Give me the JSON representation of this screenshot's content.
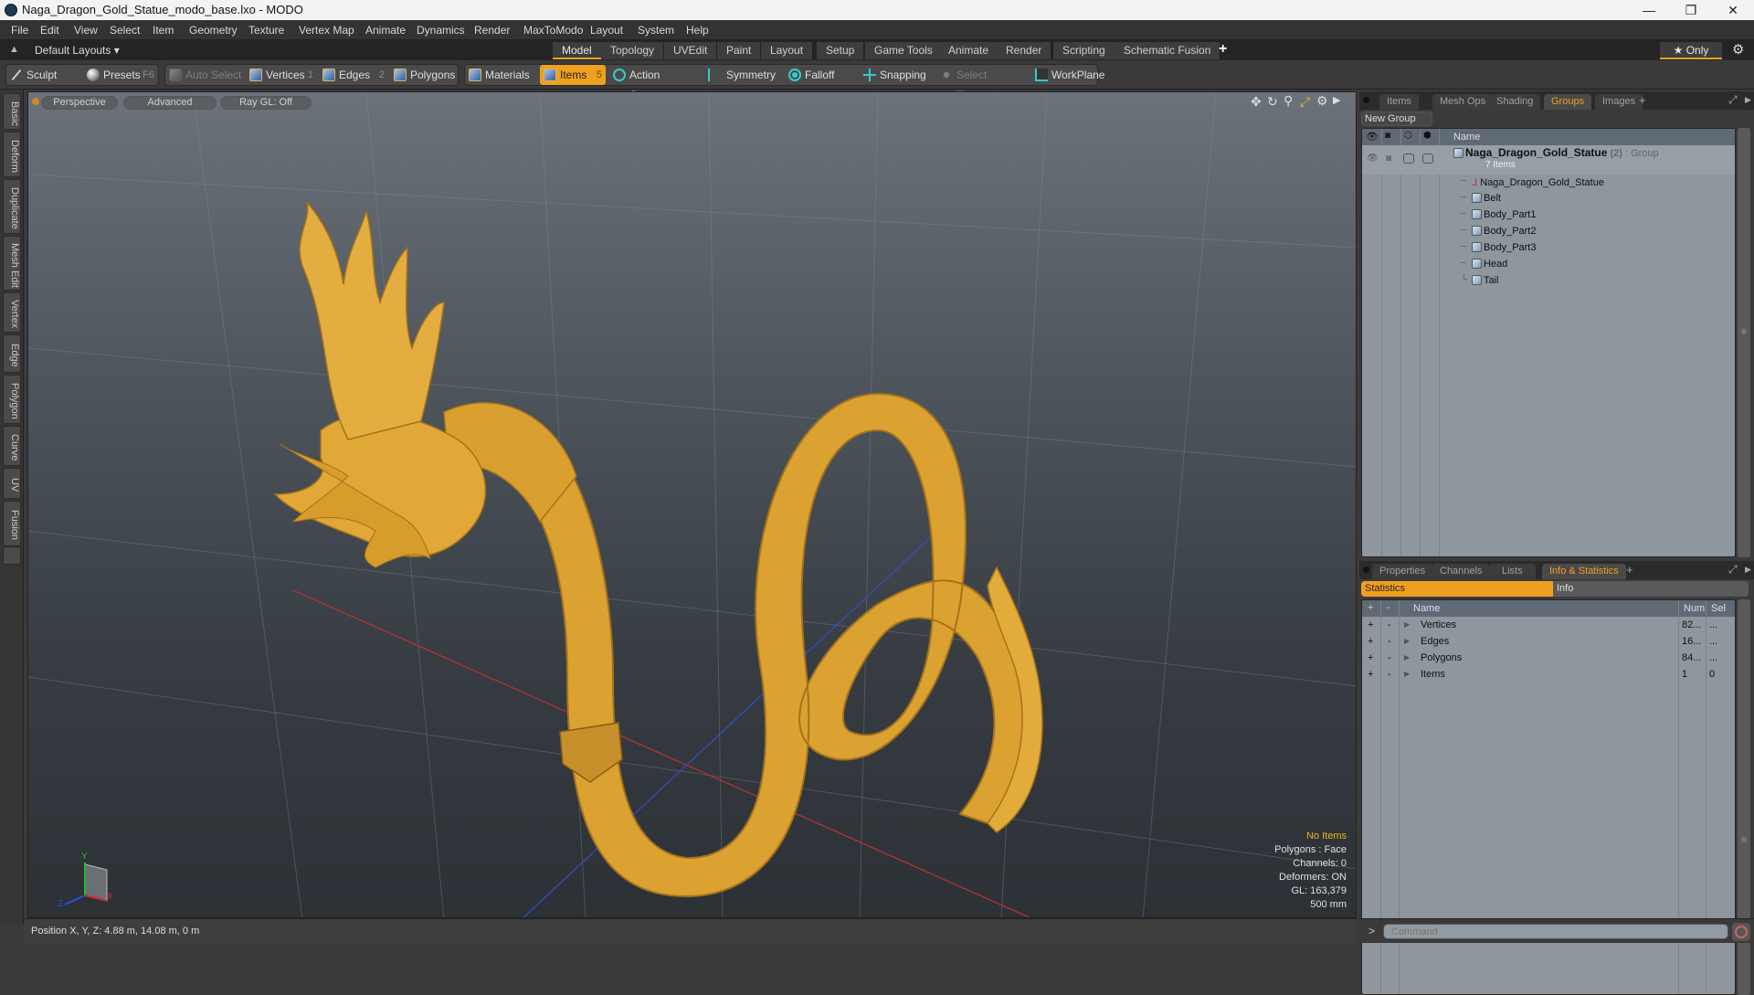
{
  "window": {
    "title": "Naga_Dragon_Gold_Statue_modo_base.lxo - MODO",
    "controls": [
      "—",
      "❐",
      "✕"
    ]
  },
  "menu": [
    "File",
    "Edit",
    "View",
    "Select",
    "Item",
    "Geometry",
    "Texture",
    "Vertex Map",
    "Animate",
    "Dynamics",
    "Render",
    "MaxToModo",
    "Layout",
    "System",
    "Help"
  ],
  "layoutbar": {
    "layouts_label": "Default Layouts ▾",
    "tabs": [
      "Model",
      "Topology",
      "UVEdit",
      "Paint",
      "Layout",
      "Setup",
      "Game Tools",
      "Animate",
      "Render",
      "Scripting",
      "Schematic Fusion"
    ],
    "active_tab": "Model",
    "add_label": "+",
    "only_label": "★  Only",
    "gear": "⚙"
  },
  "toolbar": {
    "sculpt": "Sculpt",
    "presets": "Presets",
    "presets_key": "F6",
    "auto_select": "Auto Select",
    "vertices": "Vertices",
    "vertices_key": "1",
    "edges": "Edges",
    "edges_key": "2",
    "polygons": "Polygons",
    "materials": "Materials",
    "items": "Items",
    "items_key": "5",
    "action_center": "Action Center",
    "symmetry": "Symmetry",
    "falloff": "Falloff",
    "snapping": "Snapping",
    "select_through": "Select Through",
    "workplane": "WorkPlane"
  },
  "left_tabs": [
    "Basic",
    "Deform",
    "Duplicate",
    "Mesh Edit",
    "Vertex",
    "Edge",
    "Polygon",
    "Curve",
    "UV",
    "Fusion"
  ],
  "viewport": {
    "view_label": "Perspective",
    "shading_label": "Advanced",
    "raygl_label": "Ray GL: Off",
    "hud": {
      "selection": "No Items",
      "polygons": "Polygons : Face",
      "channels": "Channels: 0",
      "deformers": "Deformers: ON",
      "gl": "GL: 163,379",
      "scale": "500 mm"
    },
    "axis_labels": {
      "x": "X",
      "y": "Y",
      "z": "Z"
    },
    "model_color": "#e0a633"
  },
  "status": {
    "position": "Position X, Y, Z:   4.88 m, 14.08 m, 0 m"
  },
  "groups_panel": {
    "tabs": [
      "Items",
      "Mesh Ops",
      "Shading",
      "Groups",
      "Images"
    ],
    "active_tab": "Groups",
    "new_group": "New Group",
    "column_name": "Name",
    "group": {
      "name": "Naga_Dragon_Gold_Statue",
      "count": "(2)",
      "type": ": Group",
      "sub": "7 Items"
    },
    "children": [
      "Naga_Dragon_Gold_Statue",
      "Belt",
      "Body_Part1",
      "Body_Part2",
      "Body_Part3",
      "Head",
      "Tail"
    ]
  },
  "info_panel": {
    "tabs": [
      "Properties",
      "Channels",
      "Lists",
      "Info & Statistics"
    ],
    "active_tab": "Info & Statistics",
    "subtabs": [
      "Statistics",
      "Info"
    ],
    "columns": {
      "plus": "+",
      "minus": "-",
      "name": "Name",
      "num": "Num",
      "sel": "Sel"
    },
    "rows": [
      {
        "name": "Vertices",
        "num": "82...",
        "sel": "..."
      },
      {
        "name": "Edges",
        "num": "16...",
        "sel": "..."
      },
      {
        "name": "Polygons",
        "num": "84...",
        "sel": "..."
      },
      {
        "name": "Items",
        "num": "1",
        "sel": "0"
      }
    ]
  },
  "command": {
    "prompt": ">",
    "placeholder": "Command"
  }
}
